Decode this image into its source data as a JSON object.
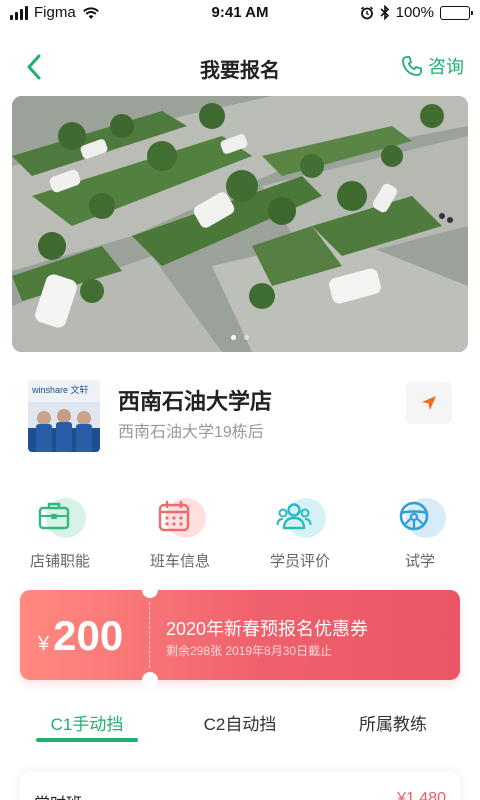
{
  "status_bar": {
    "carrier": "Figma",
    "time": "9:41 AM",
    "battery": "100%",
    "icons": [
      "signal-icon",
      "wifi-icon",
      "alarm-icon",
      "bluetooth-icon",
      "battery-icon"
    ]
  },
  "nav": {
    "title": "我要报名",
    "back_icon": "chevron-left-icon",
    "consult_label": "咨询",
    "consult_icon": "phone-icon"
  },
  "banner": {
    "slide_count": 2,
    "active_slide": 1
  },
  "store": {
    "name": "西南石油大学店",
    "address": "西南石油大学19栋后",
    "thumb_text": "winshare 文轩",
    "nav_icon": "location-arrow-icon"
  },
  "features": [
    {
      "label": "店铺职能",
      "icon": "briefcase-icon",
      "color": "#2fb980",
      "halo": "#d7f3e5"
    },
    {
      "label": "班车信息",
      "icon": "calendar-icon",
      "color": "#ef6b6b",
      "halo": "#fde0df"
    },
    {
      "label": "学员评价",
      "icon": "users-icon",
      "color": "#2bb8c4",
      "halo": "#d5f2f4"
    },
    {
      "label": "试学",
      "icon": "steering-wheel-icon",
      "color": "#2f9fd9",
      "halo": "#d6ecf9"
    }
  ],
  "coupon": {
    "currency": "¥",
    "amount": "200",
    "title": "2020年新春预报名优惠券",
    "subtitle": "剩余298张  2019年8月30日截止"
  },
  "tabs": [
    {
      "label": "C1手动挡",
      "active": true
    },
    {
      "label": "C2自动挡",
      "active": false
    },
    {
      "label": "所属教练",
      "active": false
    }
  ],
  "class_card": {
    "name": "常时班",
    "price": "¥1,480"
  },
  "colors": {
    "accent": "#1fb06e",
    "coupon_start": "#ff8a80",
    "coupon_end": "#ea5664",
    "price": "#ef5b66"
  }
}
